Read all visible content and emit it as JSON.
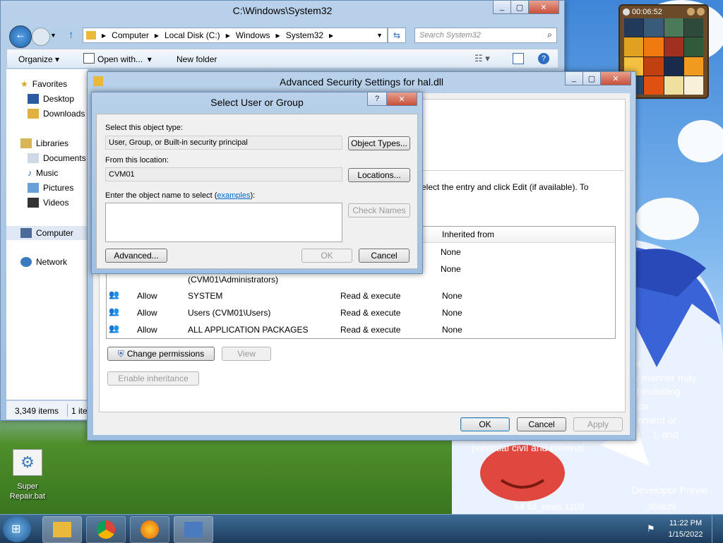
{
  "explorer": {
    "title": "C:\\Windows\\System32",
    "breadcrumbs": [
      "Computer",
      "Local Disk (C:)",
      "Windows",
      "System32"
    ],
    "search_placeholder": "Search System32",
    "toolbar": {
      "organize": "Organize",
      "open_with": "Open with...",
      "new_folder": "New folder"
    },
    "nav": {
      "favorites": "Favorites",
      "desktop": "Desktop",
      "downloads": "Downloads",
      "libraries": "Libraries",
      "documents": "Documents",
      "music": "Music",
      "pictures": "Pictures",
      "videos": "Videos",
      "computer": "Computer",
      "network": "Network"
    },
    "status": {
      "items": "3,349 items",
      "selected": "1 ite"
    }
  },
  "advanced": {
    "title": "Advanced Security Settings for hal.dll",
    "instruction": "elect the entry and click Edit (if available). To",
    "columns": {
      "inherited": "Inherited from"
    },
    "rows": [
      {
        "type": "",
        "principal": "",
        "access": "",
        "inherited": "None"
      },
      {
        "type": "",
        "principal": "(CVM01\\Administrators)",
        "access": "",
        "inherited": "None"
      },
      {
        "type": "Allow",
        "principal": "SYSTEM",
        "access": "Read & execute",
        "inherited": "None"
      },
      {
        "type": "Allow",
        "principal": "Users (CVM01\\Users)",
        "access": "Read & execute",
        "inherited": "None"
      },
      {
        "type": "Allow",
        "principal": "ALL APPLICATION PACKAGES",
        "access": "Read & execute",
        "inherited": "None"
      }
    ],
    "buttons": {
      "change_permissions": "Change permissions",
      "view": "View",
      "enable_inheritance": "Enable inheritance",
      "ok": "OK",
      "cancel": "Cancel",
      "apply": "Apply"
    }
  },
  "select_dialog": {
    "title": "Select User or Group",
    "object_type_label": "Select this object type:",
    "object_type_value": "User, Group, or Built-in security principal",
    "object_types_button": "Object Types...",
    "location_label": "From this location:",
    "location_value": "CVM01",
    "locations_button": "Locations...",
    "name_label": "Enter the object name to select (",
    "examples_link": "examples",
    "name_label_end": "):",
    "name_value": "",
    "check_names_button": "Check Names",
    "advanced_button": "Advanced...",
    "ok_button": "OK",
    "cancel_button": "Cancel"
  },
  "gadget": {
    "timer": "00:06:52"
  },
  "desktop_icon": {
    "label": "Super Repair.bat"
  },
  "watermark": {
    "line1": "al",
    "line2": "ny manner may",
    "line3": "d including",
    "line4": "ca",
    "line5": "nment or",
    "line6": "), and",
    "line7": "potential civil and criminal",
    "build1": "Developer Previe",
    "build2": "64.fbl_eeap.1108",
    "build3": ".959cf9"
  },
  "clock": {
    "time": "11:22 PM",
    "date": "1/15/2022"
  },
  "colors": {
    "accent": "#0066cc",
    "taskbar": "#1d3b5c"
  }
}
